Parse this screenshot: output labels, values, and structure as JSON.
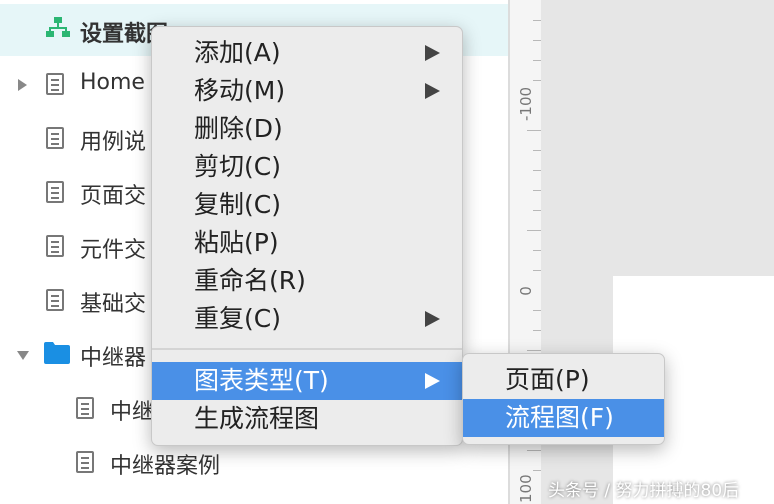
{
  "tree": {
    "items": [
      {
        "label": "设置截图"
      },
      {
        "label": "Home"
      },
      {
        "label": "用例说"
      },
      {
        "label": "页面交"
      },
      {
        "label": "元件交"
      },
      {
        "label": "基础交"
      },
      {
        "label": "中继器"
      },
      {
        "label": "中继"
      },
      {
        "label": "中继器案例"
      }
    ]
  },
  "ruler": {
    "labels": [
      "-100",
      "0",
      "100"
    ]
  },
  "context_menu": {
    "items": [
      {
        "label": "添加(A)"
      },
      {
        "label": "移动(M)"
      },
      {
        "label": "删除(D)"
      },
      {
        "label": "剪切(C)"
      },
      {
        "label": "复制(C)"
      },
      {
        "label": "粘贴(P)"
      },
      {
        "label": "重命名(R)"
      },
      {
        "label": "重复(C)"
      },
      {
        "label": "图表类型(T)"
      },
      {
        "label": "生成流程图"
      }
    ]
  },
  "submenu": {
    "items": [
      {
        "label": "页面(P)"
      },
      {
        "label": "流程图(F)"
      }
    ]
  },
  "watermark": "头条号 / 努力拼搏的80后",
  "colors": {
    "highlight": "#4a90e7",
    "selected_row": "#e6f6f8",
    "folder": "#1a8fe3",
    "flow_icon": "#2bb673"
  }
}
